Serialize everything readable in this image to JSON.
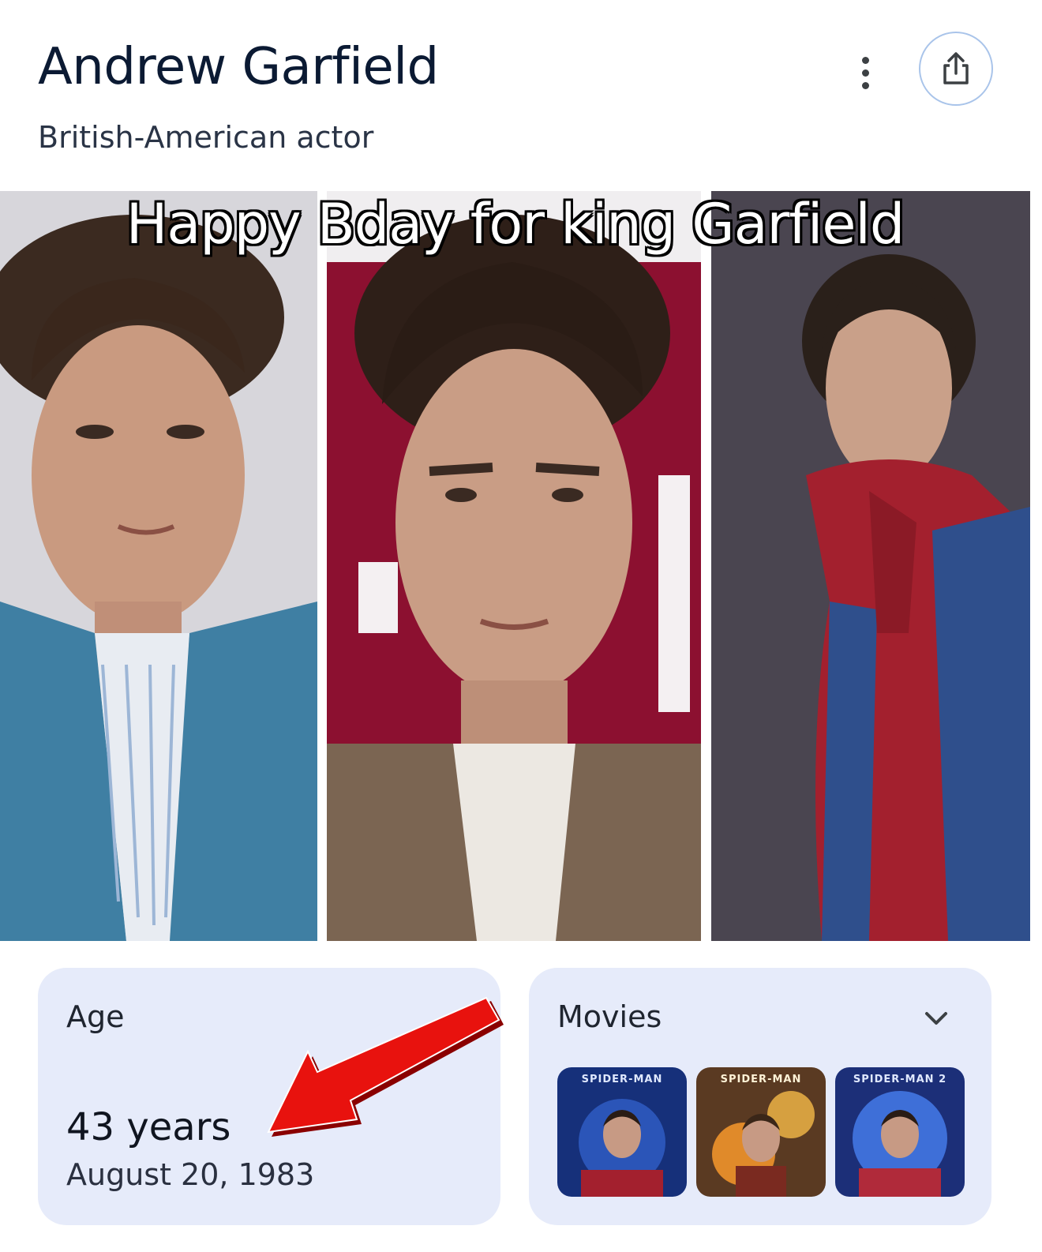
{
  "header": {
    "title": "Andrew Garfield",
    "subtitle": "British-American actor",
    "more_icon": "more-vertical-icon",
    "share_icon": "share-icon"
  },
  "gallery": {
    "caption": "Happy Bday for king Garfield",
    "photos": [
      "photo-blue-suit",
      "photo-red-backdrop",
      "photo-spider-suit"
    ]
  },
  "age": {
    "label": "Age",
    "value": "43 years",
    "birthdate": "August 20, 1983"
  },
  "movies": {
    "label": "Movies",
    "expand_icon": "chevron-down-icon",
    "posters": [
      {
        "label": "SPIDER-MAN"
      },
      {
        "label": "SPIDER-MAN"
      },
      {
        "label": "SPIDER-MAN 2"
      }
    ]
  },
  "colors": {
    "title": "#0b1a33",
    "card_bg": "#e6ebfa",
    "share_border": "#a9c4ea",
    "annotation_arrow": "#e8120e"
  }
}
